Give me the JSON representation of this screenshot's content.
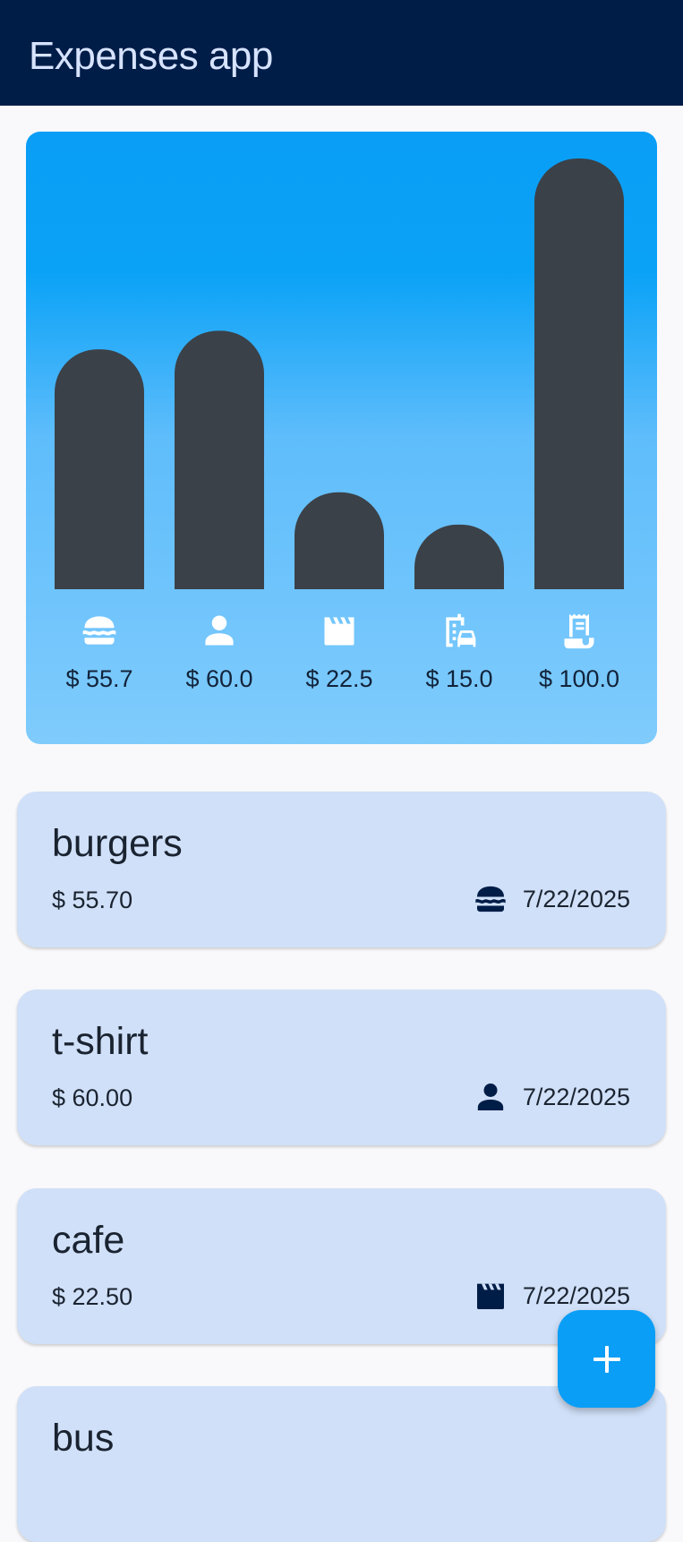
{
  "app_bar": {
    "title": "Expenses app"
  },
  "colors": {
    "app_bar_bg": "#001d47",
    "app_bar_title": "#d7e3ff",
    "bar_fill": "#3b4148",
    "card_bg": "#d0e0f8",
    "fab_bg": "#0a9ef6",
    "page_bg": "#f9f9fb"
  },
  "chart_data": {
    "type": "bar",
    "categories": [
      "food",
      "clothes",
      "leisure",
      "travel",
      "bills"
    ],
    "values": [
      55.7,
      60.0,
      22.5,
      15.0,
      100.0
    ],
    "category_icons": [
      "burger-icon",
      "person-icon",
      "clapperboard-icon",
      "city-car-icon",
      "receipt-icon"
    ],
    "value_labels": [
      "$ 55.7",
      "$ 60.0",
      "$ 22.5",
      "$ 15.0",
      "$ 100.0"
    ],
    "ylim": [
      0,
      100
    ],
    "grid": false
  },
  "expenses": [
    {
      "title": "burgers",
      "amount": "$ 55.70",
      "icon": "burger-icon",
      "date": "7/22/2025"
    },
    {
      "title": "t-shirt",
      "amount": "$ 60.00",
      "icon": "person-icon",
      "date": "7/22/2025"
    },
    {
      "title": "cafe",
      "amount": "$ 22.50",
      "icon": "clapperboard-icon",
      "date": "7/22/2025"
    },
    {
      "title": "bus"
    }
  ],
  "fab": {
    "icon": "plus-icon"
  }
}
